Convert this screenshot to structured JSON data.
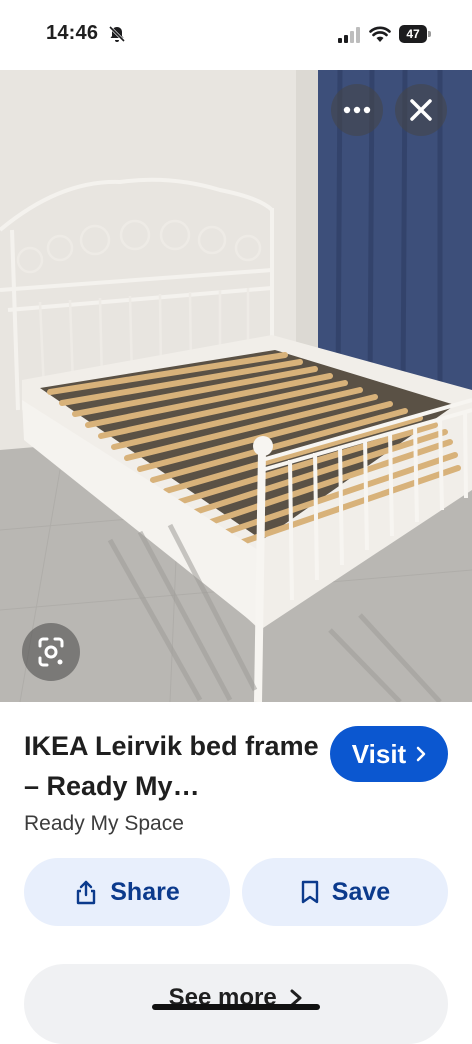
{
  "status_bar": {
    "time": "14:46",
    "battery_level": "47",
    "icons": [
      "bell-slash-icon",
      "cellular-signal-icon",
      "wifi-icon",
      "battery-icon"
    ]
  },
  "image_viewer": {
    "icons": [
      "more-horizontal-icon",
      "close-icon",
      "google-lens-icon"
    ]
  },
  "result": {
    "title": "IKEA Leirvik bed frame – Ready My…",
    "source": "Ready My Space",
    "visit_label": "Visit",
    "share_label": "Share",
    "save_label": "Save",
    "see_more_label": "See more"
  },
  "colors": {
    "accent": "#0b57d0",
    "pill_bg": "#e8effc",
    "pill_text": "#0b3a8c"
  }
}
